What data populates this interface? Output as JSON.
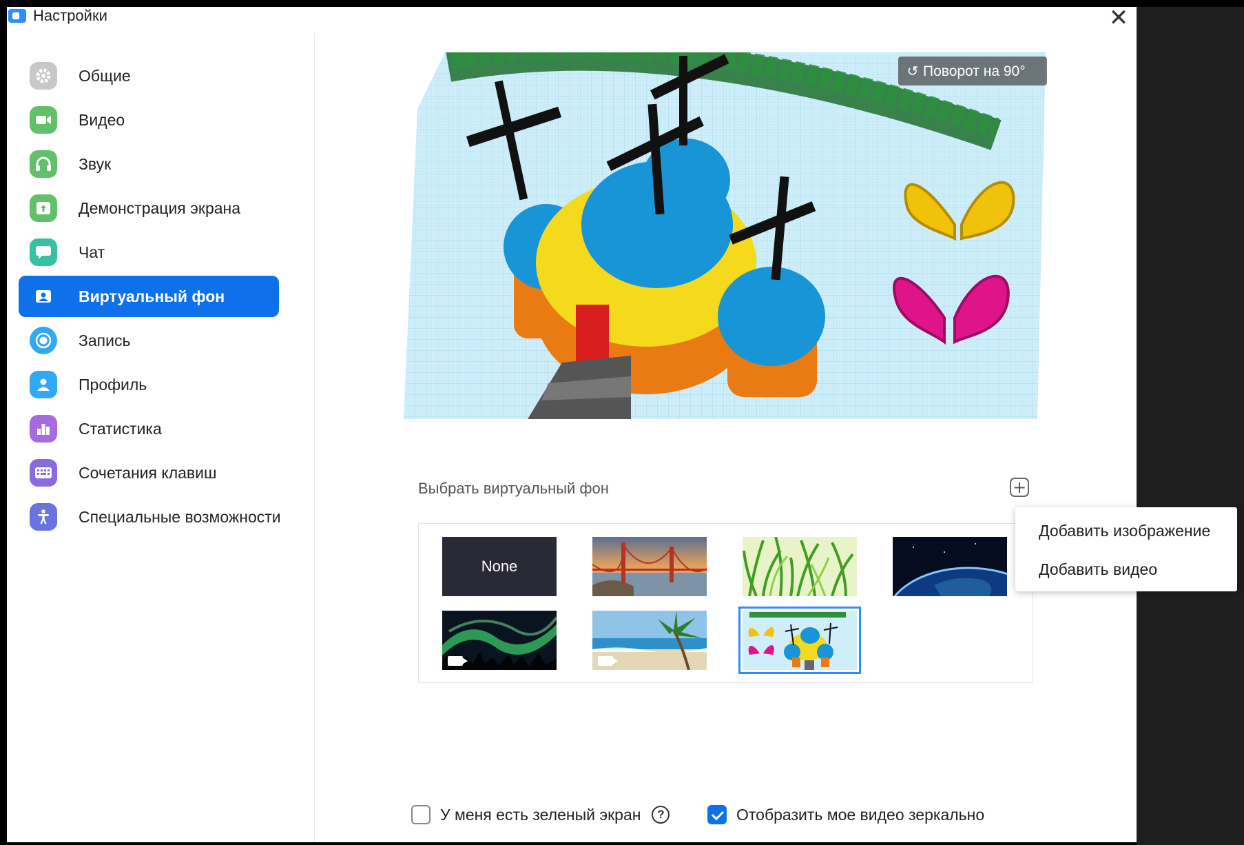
{
  "window": {
    "title": "Настройки"
  },
  "sidebar": {
    "items": [
      {
        "label": "Общие",
        "icon": "gear-icon",
        "color": "#b9b9b9"
      },
      {
        "label": "Видео",
        "icon": "video-camera-icon",
        "color": "#63c06a"
      },
      {
        "label": "Звук",
        "icon": "headphones-icon",
        "color": "#63c06a"
      },
      {
        "label": "Демонстрация экрана",
        "icon": "share-screen-icon",
        "color": "#63c06a"
      },
      {
        "label": "Чат",
        "icon": "chat-bubble-icon",
        "color": "#38c0a2"
      },
      {
        "label": "Виртуальный фон",
        "icon": "virtual-background-icon",
        "color": "#0e71eb",
        "active": true
      },
      {
        "label": "Запись",
        "icon": "record-icon",
        "color": "#2fa8f5"
      },
      {
        "label": "Профиль",
        "icon": "user-icon",
        "color": "#2fa8f5"
      },
      {
        "label": "Статистика",
        "icon": "bar-chart-icon",
        "color": "#a56ae0"
      },
      {
        "label": "Сочетания клавиш",
        "icon": "keyboard-icon",
        "color": "#8a6ae0"
      },
      {
        "label": "Специальные возможности",
        "icon": "accessibility-icon",
        "color": "#6a74e0"
      }
    ]
  },
  "preview": {
    "rotate_label": "Поворот на 90°"
  },
  "backgrounds": {
    "section_label": "Выбрать виртуальный фон",
    "add_icon": "plus-icon",
    "items": [
      {
        "label": "None",
        "type": "none"
      },
      {
        "type": "image",
        "subject": "bridge"
      },
      {
        "type": "image",
        "subject": "grass"
      },
      {
        "type": "image",
        "subject": "earth"
      },
      {
        "type": "video",
        "subject": "aurora"
      },
      {
        "type": "video",
        "subject": "beach"
      },
      {
        "type": "image",
        "subject": "custom",
        "selected": true
      }
    ]
  },
  "add_menu": {
    "items": [
      "Добавить изображение",
      "Добавить видео"
    ]
  },
  "options": {
    "green_screen_label": "У меня есть зеленый экран",
    "green_screen_checked": false,
    "mirror_label": "Отобразить мое видео зеркально",
    "mirror_checked": true
  },
  "colors": {
    "accent": "#0e71eb",
    "selection": "#2d8cff"
  }
}
